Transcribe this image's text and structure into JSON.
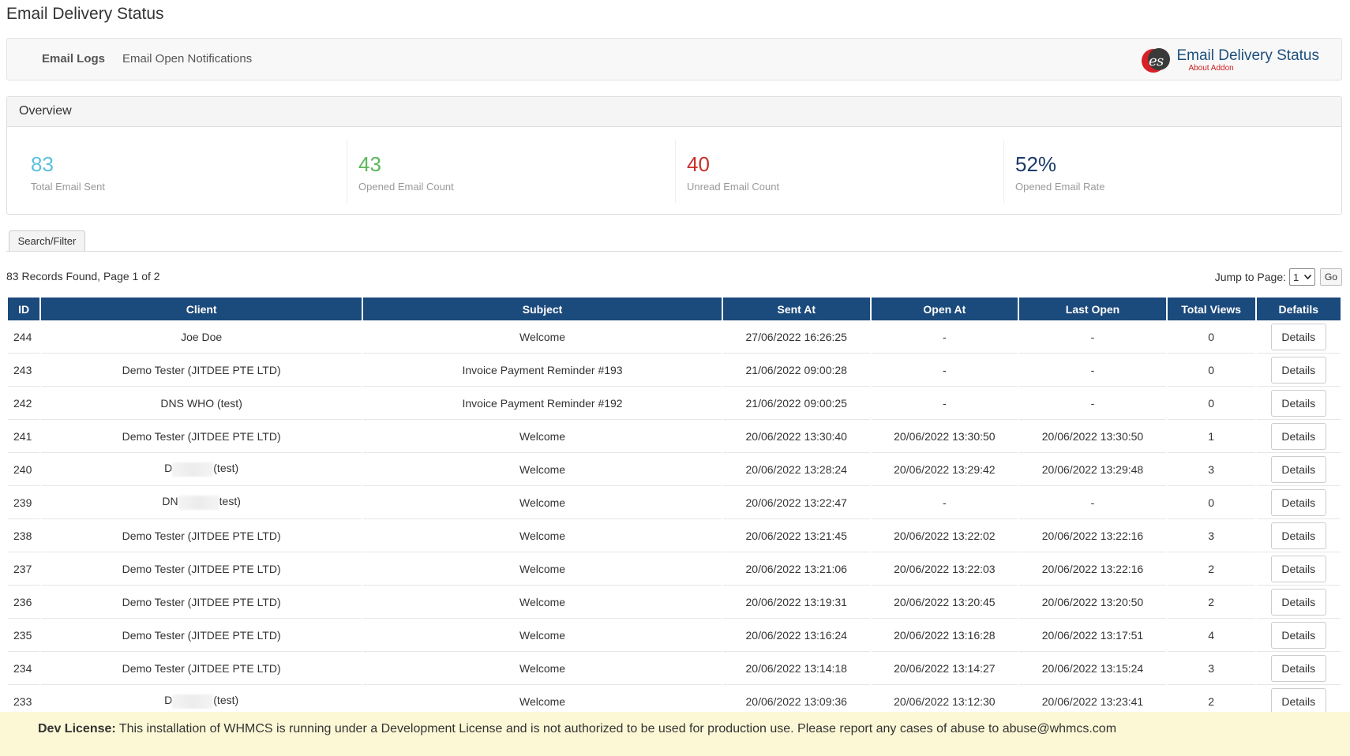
{
  "page": {
    "title": "Email Delivery Status"
  },
  "nav": {
    "items": [
      {
        "label": "Email Logs",
        "active": true
      },
      {
        "label": "Email Open Notifications",
        "active": false
      }
    ],
    "brand": {
      "title": "Email Delivery Status",
      "subtitle": "About Addon"
    }
  },
  "overview": {
    "heading": "Overview",
    "stats": [
      {
        "value": "83",
        "label": "Total Email Sent",
        "color": "#5bc0de"
      },
      {
        "value": "43",
        "label": "Opened Email Count",
        "color": "#5cb85c"
      },
      {
        "value": "40",
        "label": "Unread Email Count",
        "color": "#c9302c"
      },
      {
        "value": "52%",
        "label": "Opened Email Rate",
        "color": "#1d3c6e"
      }
    ]
  },
  "filter": {
    "tab_label": "Search/Filter"
  },
  "pagination": {
    "records_text": "83 Records Found, Page 1 of 2",
    "jump_label": "Jump to Page:",
    "page_value": "1",
    "go_label": "Go"
  },
  "table": {
    "columns": [
      "ID",
      "Client",
      "Subject",
      "Sent At",
      "Open At",
      "Last Open",
      "Total Views",
      "Defatils"
    ],
    "rows": [
      {
        "id": "244",
        "client": "Joe Doe",
        "client_redacted": false,
        "subject": "Welcome",
        "sent": "27/06/2022 16:26:25",
        "open": "-",
        "last": "-",
        "views": "0",
        "action": "Details"
      },
      {
        "id": "243",
        "client": "Demo Tester (JITDEE PTE LTD)",
        "client_redacted": false,
        "subject": "Invoice Payment Reminder #193",
        "sent": "21/06/2022 09:00:28",
        "open": "-",
        "last": "-",
        "views": "0",
        "action": "Details"
      },
      {
        "id": "242",
        "client": "DNS WHO (test)",
        "client_redacted": false,
        "subject": "Invoice Payment Reminder #192",
        "sent": "21/06/2022 09:00:25",
        "open": "-",
        "last": "-",
        "views": "0",
        "action": "Details"
      },
      {
        "id": "241",
        "client": "Demo Tester (JITDEE PTE LTD)",
        "client_redacted": false,
        "subject": "Welcome",
        "sent": "20/06/2022 13:30:40",
        "open": "20/06/2022 13:30:50",
        "last": "20/06/2022 13:30:50",
        "views": "1",
        "action": "Details"
      },
      {
        "id": "240",
        "client_prefix": "D",
        "client_suffix": "(test)",
        "client_redacted": true,
        "subject": "Welcome",
        "sent": "20/06/2022 13:28:24",
        "open": "20/06/2022 13:29:42",
        "last": "20/06/2022 13:29:48",
        "views": "3",
        "action": "Details"
      },
      {
        "id": "239",
        "client_prefix": "DN",
        "client_suffix": "test)",
        "client_redacted": true,
        "subject": "Welcome",
        "sent": "20/06/2022 13:22:47",
        "open": "-",
        "last": "-",
        "views": "0",
        "action": "Details"
      },
      {
        "id": "238",
        "client": "Demo Tester (JITDEE PTE LTD)",
        "client_redacted": false,
        "subject": "Welcome",
        "sent": "20/06/2022 13:21:45",
        "open": "20/06/2022 13:22:02",
        "last": "20/06/2022 13:22:16",
        "views": "3",
        "action": "Details"
      },
      {
        "id": "237",
        "client": "Demo Tester (JITDEE PTE LTD)",
        "client_redacted": false,
        "subject": "Welcome",
        "sent": "20/06/2022 13:21:06",
        "open": "20/06/2022 13:22:03",
        "last": "20/06/2022 13:22:16",
        "views": "2",
        "action": "Details"
      },
      {
        "id": "236",
        "client": "Demo Tester (JITDEE PTE LTD)",
        "client_redacted": false,
        "subject": "Welcome",
        "sent": "20/06/2022 13:19:31",
        "open": "20/06/2022 13:20:45",
        "last": "20/06/2022 13:20:50",
        "views": "2",
        "action": "Details"
      },
      {
        "id": "235",
        "client": "Demo Tester (JITDEE PTE LTD)",
        "client_redacted": false,
        "subject": "Welcome",
        "sent": "20/06/2022 13:16:24",
        "open": "20/06/2022 13:16:28",
        "last": "20/06/2022 13:17:51",
        "views": "4",
        "action": "Details"
      },
      {
        "id": "234",
        "client": "Demo Tester (JITDEE PTE LTD)",
        "client_redacted": false,
        "subject": "Welcome",
        "sent": "20/06/2022 13:14:18",
        "open": "20/06/2022 13:14:27",
        "last": "20/06/2022 13:15:24",
        "views": "3",
        "action": "Details"
      },
      {
        "id": "233",
        "client_prefix": "D",
        "client_suffix": "(test)",
        "client_redacted": true,
        "subject": "Welcome",
        "sent": "20/06/2022 13:09:36",
        "open": "20/06/2022 13:12:30",
        "last": "20/06/2022 13:23:41",
        "views": "2",
        "action": "Details"
      }
    ]
  },
  "license": {
    "label": "Dev License:",
    "text": "This installation of WHMCS is running under a Development License and is not authorized to be used for production use. Please report any cases of abuse to abuse@whmcs.com"
  }
}
